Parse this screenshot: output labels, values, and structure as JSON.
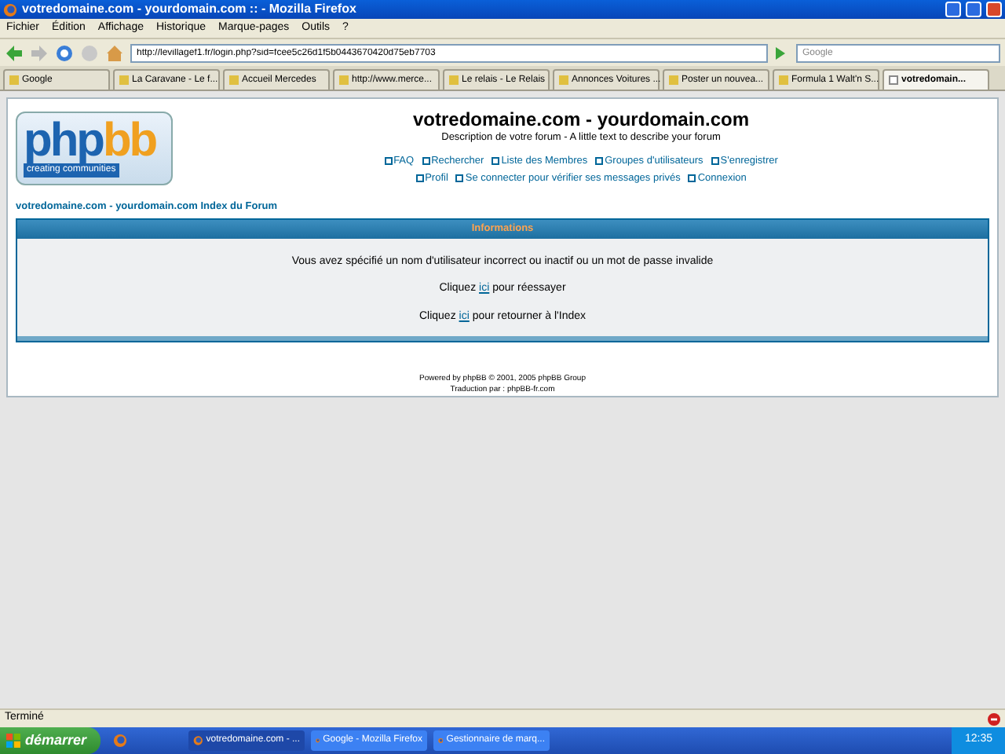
{
  "window": {
    "title": "votredomaine.com - yourdomain.com :: - Mozilla Firefox"
  },
  "menu": [
    "Fichier",
    "Édition",
    "Affichage",
    "Historique",
    "Marque-pages",
    "Outils",
    "?"
  ],
  "address": {
    "value": "http://levillagef1.fr/login.php?sid=fcee5c26d1f5b0443670420d75eb7703"
  },
  "search": {
    "placeholder": "Google"
  },
  "tabs": [
    {
      "label": "Google",
      "selected": false
    },
    {
      "label": "La Caravane - Le f...",
      "selected": false
    },
    {
      "label": "Accueil Mercedes",
      "selected": false
    },
    {
      "label": "http://www.merce...",
      "selected": false
    },
    {
      "label": "Le relais - Le Relais",
      "selected": false
    },
    {
      "label": "Annonces Voitures ...",
      "selected": false
    },
    {
      "label": "Poster un nouvea...",
      "selected": false
    },
    {
      "label": "Formula 1 Walt'n S...",
      "selected": false
    },
    {
      "label": "votredomain...",
      "selected": true
    }
  ],
  "page": {
    "logo": {
      "wordmark_1": "php",
      "wordmark_2": "bb",
      "tagline": "creating communities"
    },
    "site_title": "votredomaine.com - yourdomain.com",
    "site_description": "Description de votre forum - A little text to describe your forum",
    "nav_rows": [
      [
        "FAQ",
        "Rechercher",
        "Liste des Membres",
        "Groupes d'utilisateurs",
        "S'enregistrer"
      ],
      [
        "Profil",
        "Se connecter pour vérifier ses messages privés",
        "Connexion"
      ]
    ],
    "breadcrumb": "votredomaine.com - yourdomain.com Index du Forum",
    "info": {
      "title": "Informations",
      "message": "Vous avez spécifié un nom d'utilisateur incorrect ou inactif ou un mot de passe invalide",
      "links": [
        {
          "before": "Cliquez",
          "link": "ici",
          "after": "pour réessayer"
        },
        {
          "before": "Cliquez",
          "link": "ici",
          "after": "pour retourner à l'Index"
        }
      ]
    },
    "footer": [
      "Powered by phpBB © 2001, 2005 phpBB Group",
      "Traduction par : phpBB-fr.com"
    ]
  },
  "status_bar": "Terminé",
  "taskbar": {
    "start": "démarrer",
    "tasks": [
      {
        "label": "votredomaine.com - ...",
        "selected": true
      },
      {
        "label": "Google - Mozilla Firefox",
        "selected": false
      },
      {
        "label": "Gestionnaire de marq...",
        "selected": false
      }
    ],
    "clock": "12:35"
  }
}
